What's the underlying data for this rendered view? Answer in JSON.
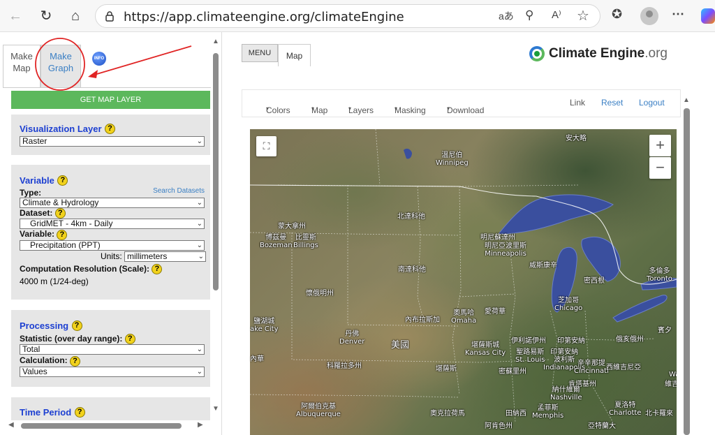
{
  "browser": {
    "url": "https://app.climateengine.org/climateEngine",
    "read_aloud_icon": "A⁾"
  },
  "tabs": {
    "make_map": "Make\nMap",
    "make_graph": "Make\nGraph",
    "info": "INFO"
  },
  "get_map_layer": "GET MAP LAYER",
  "visualization": {
    "title": "Visualization Layer",
    "value": "Raster"
  },
  "variable": {
    "title": "Variable",
    "search_link": "Search Datasets",
    "type_label": "Type:",
    "type_value": "Climate & Hydrology",
    "dataset_label": "Dataset:",
    "dataset_value": "GridMET - 4km - Daily",
    "variable_label": "Variable:",
    "variable_value": "Precipitation (PPT)",
    "units_label": "Units:",
    "units_value": "millimeters",
    "resolution_label": "Computation Resolution (Scale):",
    "resolution_value": "4000 m (1/24-deg)"
  },
  "processing": {
    "title": "Processing",
    "statistic_label": "Statistic (over day range):",
    "statistic_value": "Total",
    "calculation_label": "Calculation:",
    "calculation_value": "Values"
  },
  "time_period": {
    "title": "Time Period"
  },
  "map_header": {
    "menu": "MENU",
    "map_tab": "Map",
    "logo_main": "Climate Engine",
    "logo_suffix": ".org"
  },
  "toolbar": {
    "colors": "Colors",
    "map": "Map",
    "layers": "Layers",
    "masking": "Masking",
    "download": "Download",
    "link": "Link",
    "reset": "Reset",
    "logout": "Logout"
  },
  "map_labels": [
    {
      "text": "安大略"
    },
    {
      "text": "溫尼伯\nWinnipeg"
    },
    {
      "text": "北達科他"
    },
    {
      "text": "蒙大拿州"
    },
    {
      "text": "博茲曼\nBozeman"
    },
    {
      "text": "比靈斯\nBillings"
    },
    {
      "text": "明尼蘇達州"
    },
    {
      "text": "明尼亞波里斯\nMinneapolis"
    },
    {
      "text": "威斯康辛"
    },
    {
      "text": "南達科他"
    },
    {
      "text": "密西根"
    },
    {
      "text": "多倫多\nToronto"
    },
    {
      "text": "懷俄明州"
    },
    {
      "text": "芝加哥\nChicago"
    },
    {
      "text": "奧馬哈\nOmaha"
    },
    {
      "text": "愛荷華"
    },
    {
      "text": "內布拉斯加"
    },
    {
      "text": "鹽湖城\nake City"
    },
    {
      "text": "丹佛\nDenver"
    },
    {
      "text": "美國"
    },
    {
      "text": "堪薩斯城\nKansas City"
    },
    {
      "text": "聖路易斯\nSt. Louis"
    },
    {
      "text": "印第安納\n波利斯\nIndianapolis"
    },
    {
      "text": "伊利諾伊州"
    },
    {
      "text": "印第安納"
    },
    {
      "text": "俄亥俄州"
    },
    {
      "text": "賓夕"
    },
    {
      "text": "內華"
    },
    {
      "text": "科羅拉多州"
    },
    {
      "text": "堪薩斯"
    },
    {
      "text": "密蘇里州"
    },
    {
      "text": "辛辛那提\nCincinnati"
    },
    {
      "text": "西維吉尼亞"
    },
    {
      "text": "肯塔基州"
    },
    {
      "text": "維吉尼"
    },
    {
      "text": "Wa"
    },
    {
      "text": "納什維爾\nNashville"
    },
    {
      "text": "阿爾伯克基\nAlbuquerque"
    },
    {
      "text": "奧克拉荷馬"
    },
    {
      "text": "田納西"
    },
    {
      "text": "孟菲斯\nMemphis"
    },
    {
      "text": "夏洛特\nCharlotte"
    },
    {
      "text": "北卡羅來"
    },
    {
      "text": "阿肯色州"
    },
    {
      "text": "亞特蘭大"
    }
  ]
}
